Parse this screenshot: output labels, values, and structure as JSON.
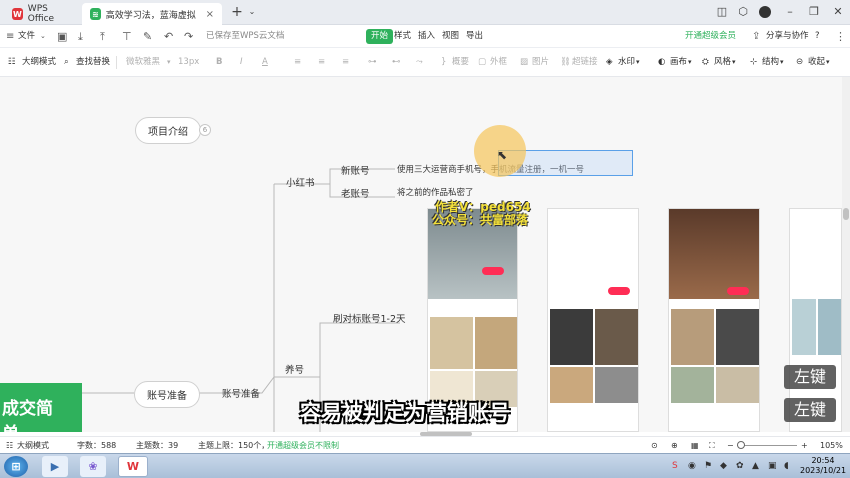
{
  "tabs": [
    {
      "label": "WPS Office",
      "active": false
    },
    {
      "label": "高效学习法，蓝海虚拟资源项目，",
      "active": true
    }
  ],
  "new_tab": "+",
  "menubar": {
    "file": "文件",
    "cloud_status": "已保存至WPS云文档",
    "tabs": [
      "开始",
      "样式",
      "插入",
      "视图",
      "导出"
    ],
    "vip": "开通超级会员",
    "share": "分享与协作",
    "help": "?"
  },
  "toolbar": {
    "outline_mode": "大纲模式",
    "find_replace": "查找替换",
    "font": "微软雅黑",
    "size": "13px",
    "bold": "B",
    "italic": "I",
    "color": "A",
    "summary": "概要",
    "frame": "外框",
    "image": "图片",
    "link": "超链接",
    "watermark": "水印",
    "canvas": "画布",
    "style": "风格",
    "structure": "结构",
    "collapse": "收起"
  },
  "mindmap": {
    "top_node": "项目介绍",
    "top_badge": "6",
    "xhs": "小红书",
    "new_account": "新账号",
    "new_account_note": "使用三大运营商手机号，手机流量注册，一机一号",
    "old_account": "老账号",
    "old_account_note": "将之前的作品私密了",
    "benchmark": "刷对标账号1-2天",
    "nurture": "养号",
    "prep": "账号准备",
    "prep_child": "账号准备"
  },
  "overlay": {
    "watermark_line1": "作者V：ped654",
    "watermark_line2": "公众号：共富部落",
    "subtitle": "容易被判定为营销账号",
    "left_key_1": "左键",
    "left_key_2": "左键",
    "green_text": "成交简单，"
  },
  "statusbar": {
    "outline": "大纲模式",
    "word_count": "字数：588",
    "topic_count": "主题数：39",
    "topic_limit": "主题上限：150个，",
    "upgrade": "开通超级会员不限制",
    "zoom": "105%"
  },
  "taskbar": {
    "time": "20:54",
    "date": "2023/10/21"
  },
  "colors": {
    "accent_green": "#2fb15c",
    "wps_red": "#e0353b",
    "selection_blue": "#5aa0e8"
  }
}
